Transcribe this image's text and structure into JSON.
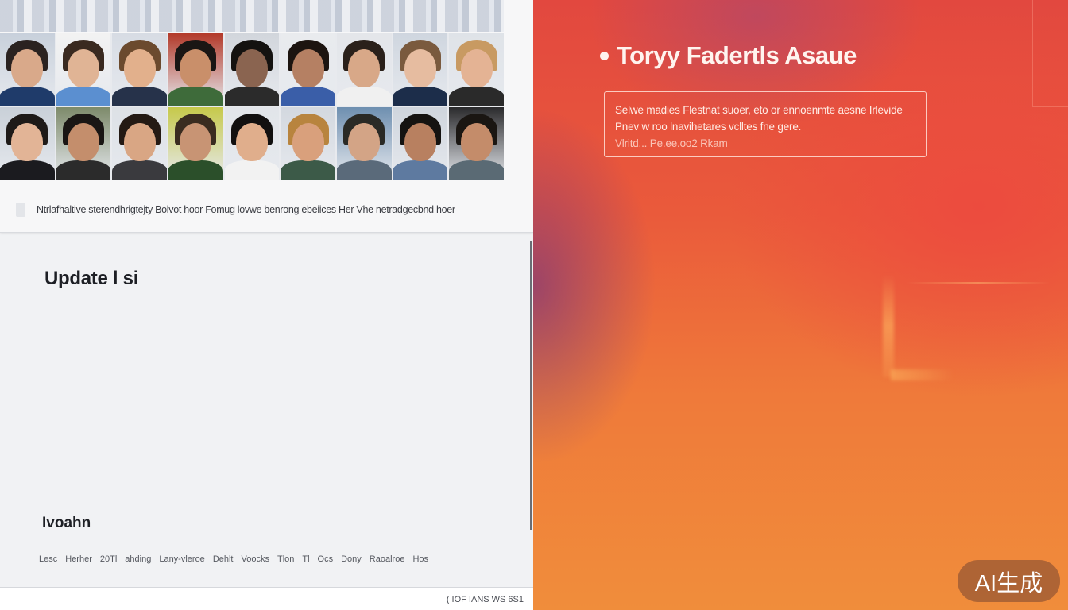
{
  "left": {
    "photo_caption": "Ntrlafhaltive sterendhrigtejty Bolvot hoor Fomug lovwe benrong ebeiices Her Vhe netradgecbnd hoer",
    "section_title": "Update l si",
    "subsection_title": "Ivoahn",
    "tags": [
      "Lesc",
      "Herher",
      "20Tl",
      "ahding",
      "Lany-vleroe",
      "Dehlt",
      "Voocks",
      "Tlon",
      "Tl",
      "Ocs",
      "Dony",
      "Raoalroe",
      "Hos"
    ],
    "footer_text": "( IOF IANS WS 6S1",
    "photos": [
      {
        "hair": "#2a2220",
        "skin": "#d9a98a",
        "shirt": "#1f3b6a",
        "bg": "#c8d0db"
      },
      {
        "hair": "#3a2a20",
        "skin": "#e0b495",
        "shirt": "#5b8fd0",
        "bg": "#f2f2f2"
      },
      {
        "hair": "#6b4a2e",
        "skin": "#e2b08c",
        "shirt": "#26324a",
        "bg": "#d7dce4"
      },
      {
        "hair": "#1a1614",
        "skin": "#c98f6a",
        "shirt": "#3e6b3a",
        "bg": "#b33a2a"
      },
      {
        "hair": "#141210",
        "skin": "#8a6450",
        "shirt": "#2b2b2b",
        "bg": "#d2d6dc"
      },
      {
        "hair": "#1c1410",
        "skin": "#b58063",
        "shirt": "#3a5ea8",
        "bg": "#e9ebee"
      },
      {
        "hair": "#2a201a",
        "skin": "#d8a888",
        "shirt": "#f0f0f0",
        "bg": "#e4e6ea"
      },
      {
        "hair": "#7a5a3e",
        "skin": "#e6bca0",
        "shirt": "#1c2d4a",
        "bg": "#cfd6df"
      },
      {
        "hair": "#c89a62",
        "skin": "#e4b394",
        "shirt": "#2a2a2a",
        "bg": "#dfe3e8"
      },
      {
        "hair": "#1e1a18",
        "skin": "#e2b496",
        "shirt": "#1b1b1f",
        "bg": "#c9d0d8"
      },
      {
        "hair": "#1a1614",
        "skin": "#c48e6c",
        "shirt": "#2b2b2b",
        "bg": "#7d8a6a"
      },
      {
        "hair": "#241a14",
        "skin": "#d9a684",
        "shirt": "#3a3a3e",
        "bg": "#dde1e6"
      },
      {
        "hair": "#3a2c20",
        "skin": "#c89474",
        "shirt": "#2b4f2a",
        "bg": "#c6c94a"
      },
      {
        "hair": "#121010",
        "skin": "#e0ae8c",
        "shirt": "#f2f2f2",
        "bg": "#e2e5ea"
      },
      {
        "hair": "#b8843e",
        "skin": "#d9a07c",
        "shirt": "#3c5a48",
        "bg": "#d3d8df"
      },
      {
        "hair": "#2a2a26",
        "skin": "#d3a486",
        "shirt": "#5a6a7a",
        "bg": "#6e8fb0"
      },
      {
        "hair": "#151311",
        "skin": "#b88060",
        "shirt": "#5e7aa0",
        "bg": "#cfd5dd"
      },
      {
        "hair": "#1a1612",
        "skin": "#c48c6a",
        "shirt": "#5a6a74",
        "bg": "#2a2a2c"
      }
    ]
  },
  "right": {
    "hero_title": "Toryy Fadertls Asaue",
    "notice_lines": [
      "Selwe madies Flestnat suoer, eto or ennoenmte aesne Irlevide",
      "Pnev w roo lnavihetares vclltes fne gere.",
      "Vlritd... Pe.ee.oo2 Rkam"
    ]
  },
  "badge": {
    "label": "AI生成"
  },
  "colors": {
    "accent_orange": "#ef7a3a",
    "accent_red": "#e2483f",
    "panel_bg": "#f1f2f4",
    "text_dark": "#1d1f24"
  }
}
